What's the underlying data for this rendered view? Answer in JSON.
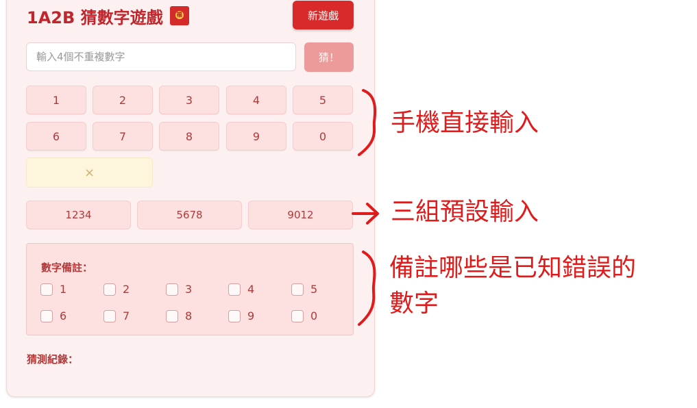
{
  "header": {
    "title": "1A2B 猜數字遊戲",
    "envelope_char": "福",
    "new_game_label": "新遊戲"
  },
  "guess": {
    "placeholder": "輸入4個不重複數字",
    "submit_label": "猜！"
  },
  "keypad": {
    "keys": [
      "1",
      "2",
      "3",
      "4",
      "5",
      "6",
      "7",
      "8",
      "9",
      "0"
    ],
    "clear_label": "×"
  },
  "presets": [
    "1234",
    "5678",
    "9012"
  ],
  "notes": {
    "title": "數字備註：",
    "digits": [
      "1",
      "2",
      "3",
      "4",
      "5",
      "6",
      "7",
      "8",
      "9",
      "0"
    ]
  },
  "history": {
    "title": "猜測紀錄："
  },
  "annotations": {
    "keypad_note": "手機直接輸入",
    "preset_note": "三組預設輸入",
    "notes_note_line1": "備註哪些是已知錯誤的",
    "notes_note_line2": "數字"
  },
  "colors": {
    "accent": "#d82a2a",
    "annotation": "#e01b1b"
  }
}
